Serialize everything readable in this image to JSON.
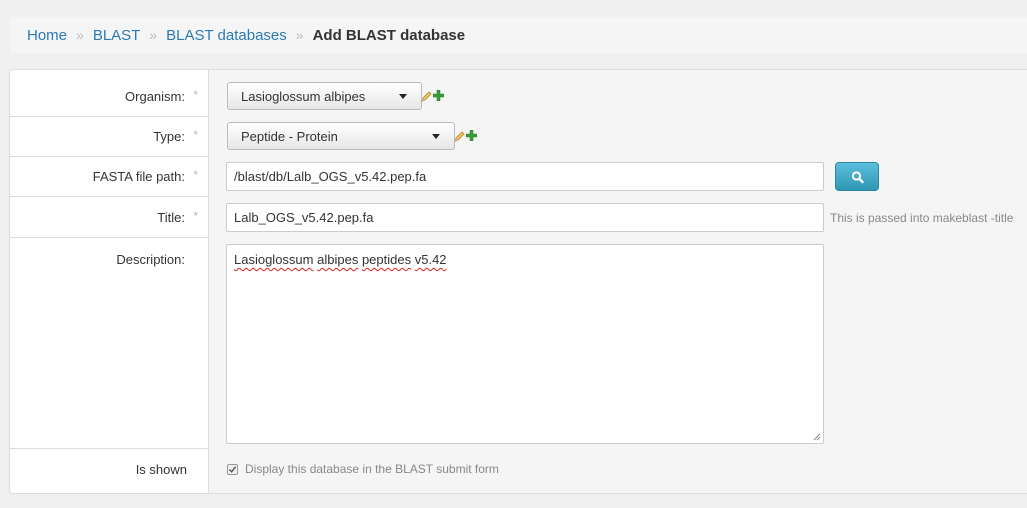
{
  "breadcrumb": {
    "items": [
      "Home",
      "BLAST",
      "BLAST databases"
    ],
    "separator": "»",
    "active": "Add BLAST database"
  },
  "form": {
    "organism": {
      "label": "Organism:",
      "required_mark": "*",
      "value": "Lasioglossum albipes"
    },
    "type": {
      "label": "Type:",
      "required_mark": "*",
      "value": "Peptide - Protein"
    },
    "fasta": {
      "label": "FASTA file path:",
      "required_mark": "*",
      "value": "/blast/db/Lalb_OGS_v5.42.pep.fa"
    },
    "title": {
      "label": "Title:",
      "required_mark": "*",
      "value": "Lalb_OGS_v5.42.pep.fa",
      "help": "This is passed into makeblast -title"
    },
    "description": {
      "label": "Description:",
      "value_words": [
        "Lasioglossum",
        "albipes",
        "peptides",
        "v5.42"
      ]
    },
    "is_shown": {
      "label": "Is shown",
      "checked": true,
      "text": "Display this database in the BLAST submit form"
    }
  },
  "icons": {
    "edit": "pencil-icon",
    "add": "plus-icon",
    "search": "search-icon",
    "check": "check-icon"
  },
  "colors": {
    "link": "#2a7ab8",
    "info_button": "#3aa9cf",
    "add_green": "#3a9a3a"
  }
}
